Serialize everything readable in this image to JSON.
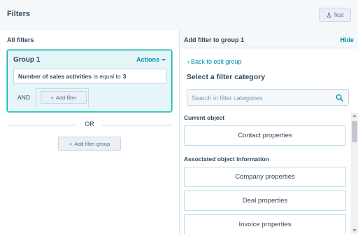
{
  "header": {
    "title": "Filters",
    "test_label": "Test"
  },
  "left": {
    "title": "All filters",
    "group": {
      "title": "Group 1",
      "actions_label": "Actions",
      "rule": {
        "property": "Number of sales activities",
        "operator": "is equal to",
        "value": "3"
      },
      "and_label": "AND",
      "add_filter_label": "Add filter"
    },
    "or_label": "OR",
    "add_group_label": "Add filter group"
  },
  "right": {
    "title": "Add filter to group 1",
    "hide_label": "Hide",
    "back_label": "Back to edit group",
    "select_title": "Select a filter category",
    "search_placeholder": "Search in filter categories",
    "sections": [
      {
        "label": "Current object",
        "items": [
          "Contact properties"
        ]
      },
      {
        "label": "Associated object information",
        "items": [
          "Company properties",
          "Deal properties",
          "Invoice properties"
        ]
      }
    ]
  },
  "colors": {
    "accent": "#0091ae",
    "group_bg": "#e5f5f8",
    "group_border": "#00bda5",
    "text": "#33475b"
  }
}
